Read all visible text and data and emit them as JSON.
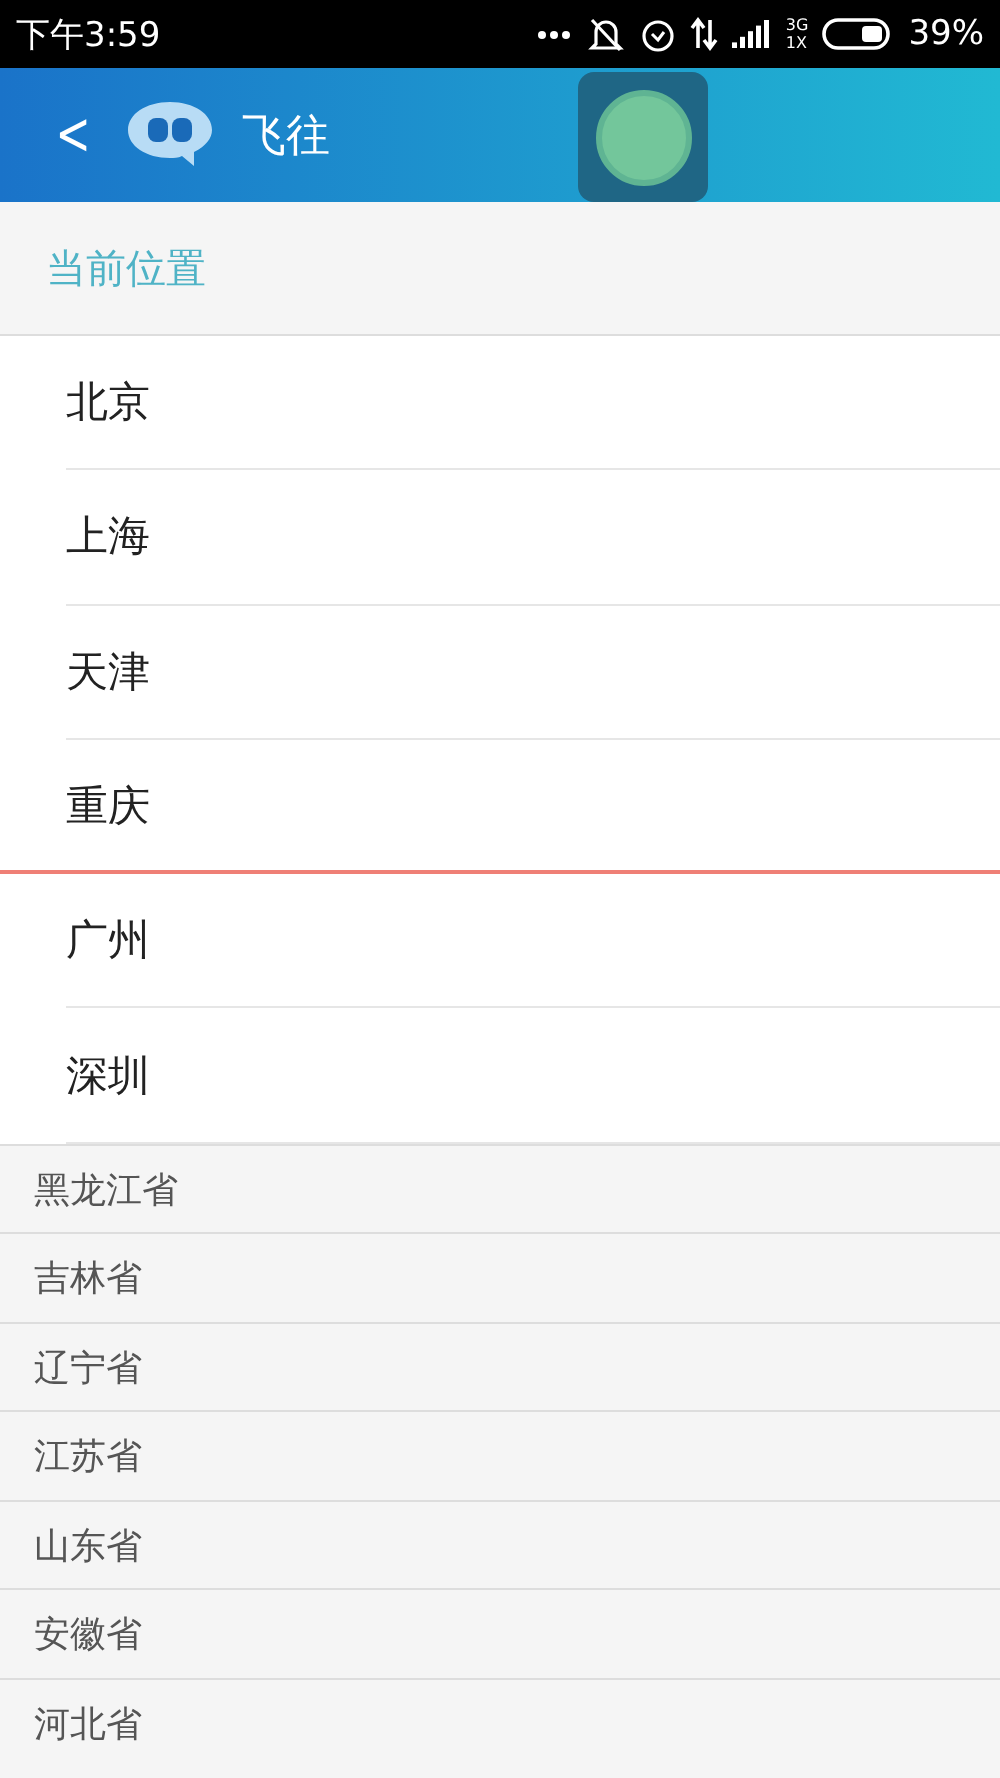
{
  "status_bar": {
    "time": "下午3:59",
    "network_top": "3G",
    "network_bottom": "1X",
    "battery": "39%"
  },
  "header": {
    "back": "<",
    "title": "飞往"
  },
  "section": {
    "title": "当前位置"
  },
  "cities": [
    {
      "name": "北京",
      "marked": false
    },
    {
      "name": "上海",
      "marked": false
    },
    {
      "name": "天津",
      "marked": false
    },
    {
      "name": "重庆",
      "marked": true
    },
    {
      "name": "广州",
      "marked": false
    },
    {
      "name": "深圳",
      "marked": false
    }
  ],
  "provinces": [
    "黑龙江省",
    "吉林省",
    "辽宁省",
    "江苏省",
    "山东省",
    "安徽省",
    "河北省"
  ]
}
